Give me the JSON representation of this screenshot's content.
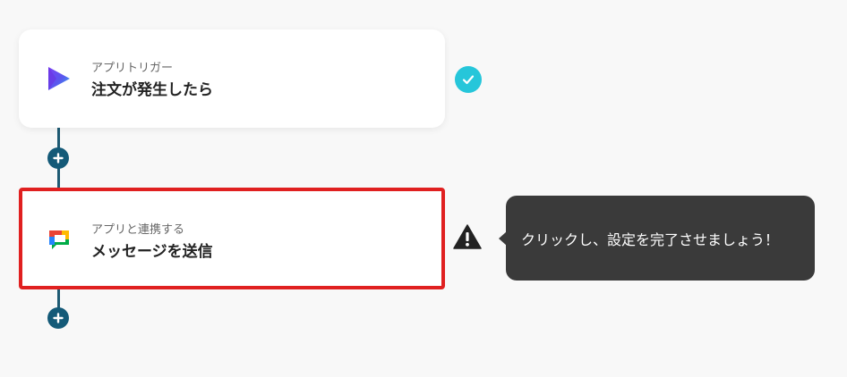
{
  "flow": {
    "trigger": {
      "subtitle": "アプリトリガー",
      "title": "注文が発生したら",
      "status": "completed"
    },
    "action": {
      "subtitle": "アプリと連携する",
      "title": "メッセージを送信",
      "status": "incomplete"
    }
  },
  "tooltip": {
    "text": "クリックし、設定を完了させましょう！"
  },
  "icons": {
    "trigger_app": "play-triangle-icon",
    "action_app": "google-chat-icon",
    "complete": "check-icon",
    "warning": "warning-icon",
    "add": "plus-icon"
  },
  "colors": {
    "check_badge": "#26c6da",
    "connector": "#145a78",
    "highlight_border": "#e02020",
    "tooltip_bg": "#3a3a3a"
  }
}
